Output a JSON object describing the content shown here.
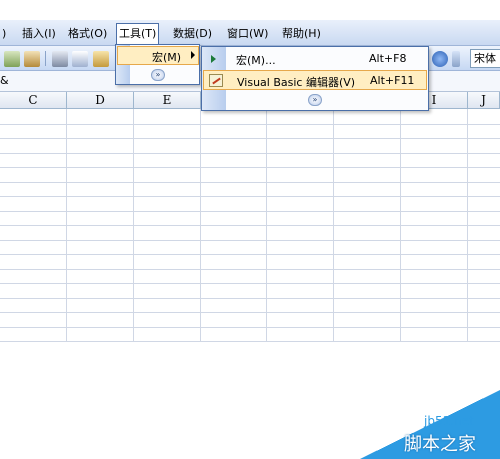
{
  "menubar": {
    "items": [
      {
        "label": ")"
      },
      {
        "label": "插入(I)"
      },
      {
        "label": "格式(O)"
      },
      {
        "label": "工具(T)"
      },
      {
        "label": "数据(D)"
      },
      {
        "label": "窗口(W)"
      },
      {
        "label": "帮助(H)"
      }
    ]
  },
  "toolbar": {
    "font_name": "宋体",
    "icons": [
      "spelling-icon",
      "research-icon",
      "cut-icon",
      "copy-icon",
      "paste-icon",
      "help-icon"
    ]
  },
  "formula_bar": {
    "name_box_fragment": "&"
  },
  "grid": {
    "column_headers": [
      "C",
      "D",
      "E",
      "",
      "",
      "",
      "I",
      "J"
    ]
  },
  "tools_menu": {
    "macro_label": "宏(M)",
    "expand_glyph": "»"
  },
  "macro_submenu": {
    "items": [
      {
        "label": "宏(M)...",
        "shortcut": "Alt+F8"
      },
      {
        "label": "Visual Basic 编辑器(V)",
        "shortcut": "Alt+F11"
      }
    ],
    "expand_glyph": "»"
  },
  "watermark": {
    "site": "jb51.net",
    "name": "脚本之家",
    "color": "#2d9be2"
  },
  "colors": {
    "menu_highlight": "#ffeec2",
    "menu_highlight_border": "#e6a84b",
    "menu_border": "#4b6fa8"
  }
}
